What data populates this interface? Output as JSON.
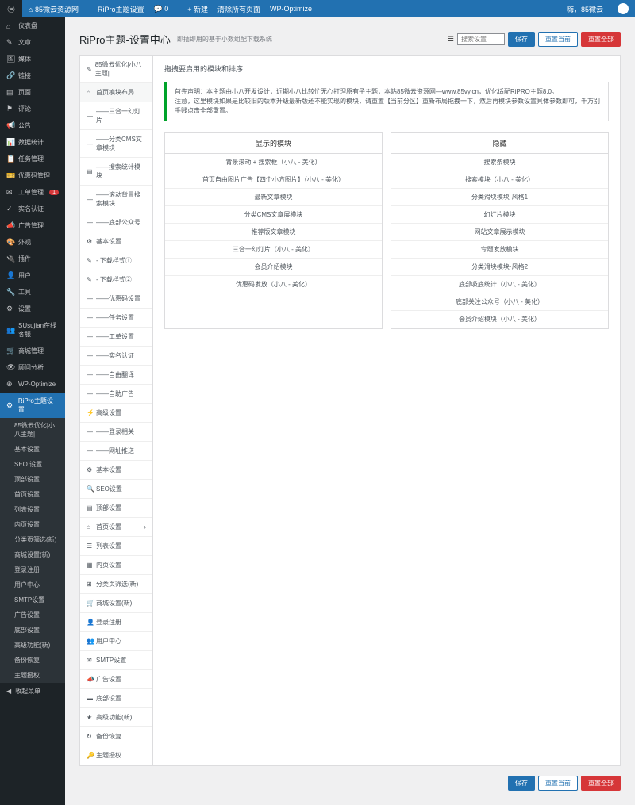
{
  "topbar": {
    "site": "85微云资源网",
    "theme": "RiPro主题设置",
    "comments": "0",
    "new": "+ 新建",
    "clear": "清除所有页面",
    "wpo": "WP-Optimize",
    "greeting": "嗨，85微云"
  },
  "sidebar": {
    "items": [
      {
        "icon": "⌂",
        "label": "仪表盘"
      },
      {
        "icon": "✎",
        "label": "文章"
      },
      {
        "icon": "🖼",
        "label": "媒体"
      },
      {
        "icon": "🔗",
        "label": "链接"
      },
      {
        "icon": "▤",
        "label": "页面"
      },
      {
        "icon": "⚑",
        "label": "评论"
      },
      {
        "icon": "📢",
        "label": "公告"
      },
      {
        "icon": "📊",
        "label": "数据统计"
      },
      {
        "icon": "📋",
        "label": "任务管理"
      },
      {
        "icon": "🎫",
        "label": "优惠码管理"
      },
      {
        "icon": "✉",
        "label": "工单管理",
        "badge": "1"
      },
      {
        "icon": "✓",
        "label": "实名认证"
      },
      {
        "icon": "📣",
        "label": "广告管理"
      },
      {
        "icon": "🎨",
        "label": "外观"
      },
      {
        "icon": "🔌",
        "label": "插件"
      },
      {
        "icon": "👤",
        "label": "用户"
      },
      {
        "icon": "🔧",
        "label": "工具"
      },
      {
        "icon": "⚙",
        "label": "设置"
      },
      {
        "icon": "👥",
        "label": "SUsujian在线客服"
      },
      {
        "icon": "🛒",
        "label": "商城管理"
      },
      {
        "icon": "👁",
        "label": "顾问分析"
      },
      {
        "icon": "⊕",
        "label": "WP-Optimize"
      },
      {
        "icon": "⚙",
        "label": "RiPro主题设置",
        "active": true
      }
    ],
    "subs": [
      "85微云优化|小八主题|",
      "基本设置",
      "SEO 设置",
      "顶部设置",
      "首页设置",
      "列表设置",
      "内页设置",
      "分类页筛选(新)",
      "商城设置(新)",
      "登录注册",
      "用户中心",
      "SMTP设置",
      "广告设置",
      "底部设置",
      "高级功能(新)",
      "备份恢复",
      "主题授权"
    ],
    "collapse": "收起菜单"
  },
  "page": {
    "title": "RiPro主题-设置中心",
    "subtitle": "即插即用的基于小数组配下载系统",
    "btn_save": "保存",
    "btn_reset": "重置当前",
    "btn_reset_all": "重置全部",
    "search_placeholder": "搜索设置"
  },
  "nav": [
    {
      "icon": "✎",
      "label": "85微云优化|小八主题|"
    },
    {
      "icon": "⌂",
      "label": "首页模块布局",
      "active": true
    },
    {
      "icon": "—",
      "label": "——三合一幻灯片"
    },
    {
      "icon": "—",
      "label": "——分类CMS文章模块"
    },
    {
      "icon": "▤",
      "label": "——搜索统计模块"
    },
    {
      "icon": "—",
      "label": "——滚动背景搜索模块"
    },
    {
      "icon": "—",
      "label": "——底部公众号"
    },
    {
      "icon": "⚙",
      "label": "基本设置"
    },
    {
      "icon": "✎",
      "label": "- 下载样式①"
    },
    {
      "icon": "✎",
      "label": "- 下载样式②"
    },
    {
      "icon": "—",
      "label": "——优惠码设置"
    },
    {
      "icon": "—",
      "label": "——任务设置"
    },
    {
      "icon": "—",
      "label": "——工单设置"
    },
    {
      "icon": "—",
      "label": "——实名认证"
    },
    {
      "icon": "—",
      "label": "——自由翻译"
    },
    {
      "icon": "—",
      "label": "——自助广告"
    },
    {
      "icon": "⚡",
      "label": "高级设置"
    },
    {
      "icon": "—",
      "label": "——登录相关"
    },
    {
      "icon": "—",
      "label": "——网址推送"
    },
    {
      "icon": "⚙",
      "label": "基本设置"
    },
    {
      "icon": "🔍",
      "label": "SEO设置"
    },
    {
      "icon": "▤",
      "label": "顶部设置"
    },
    {
      "icon": "⌂",
      "label": "首页设置",
      "sub": true
    },
    {
      "icon": "☰",
      "label": "列表设置"
    },
    {
      "icon": "▦",
      "label": "内页设置"
    },
    {
      "icon": "⊞",
      "label": "分类页筛选(新)"
    },
    {
      "icon": "🛒",
      "label": "商城设置(新)"
    },
    {
      "icon": "👤",
      "label": "登录注册"
    },
    {
      "icon": "👥",
      "label": "用户中心"
    },
    {
      "icon": "✉",
      "label": "SMTP设置"
    },
    {
      "icon": "📣",
      "label": "广告设置"
    },
    {
      "icon": "▬",
      "label": "底部设置"
    },
    {
      "icon": "★",
      "label": "高级功能(新)"
    },
    {
      "icon": "↻",
      "label": "备份恢复"
    },
    {
      "icon": "🔑",
      "label": "主题授权"
    }
  ],
  "body": {
    "heading": "拖拽要启用的模块和排序",
    "notice_line1": "首先声明：本主题由小八开发设计，近期小八比较忙无心打理原有子主题，本站85微云资源网—www.85vy.cn，优化适配RiPRO主题8.0。",
    "notice_line2": "注意，这里模块如果是比较旧的版本升级最新版还不能实现的模块，请重置【当前分区】重新布局拖拽一下，然后再模块参数设置具体参数即可，千万别手贱点击全部重置。"
  },
  "cols": {
    "show_title": "显示的模块",
    "hide_title": "隐藏",
    "show_items": [
      "背景滚动 + 搜索框（小八 - 美化）",
      "首页自由图片广告【四个小方图片】（小八 - 美化）",
      "最新文章模块",
      "分类CMS文章展模块",
      "推荐版文章模块",
      "三合一幻灯片（小八 - 美化）",
      "会员介绍模块",
      "优惠码发放（小八 - 美化）"
    ],
    "hide_items": [
      "搜索条模块",
      "搜索模块（小八 - 美化）",
      "分类滑块模块·风格1",
      "幻灯片模块",
      "网站文章展示模块",
      "专题发放模块",
      "分类滑块模块·风格2",
      "底部吸底统计（小八 - 美化）",
      "底部关注公众号（小八 - 美化）",
      "会员介绍模块（小八 - 美化）"
    ]
  }
}
